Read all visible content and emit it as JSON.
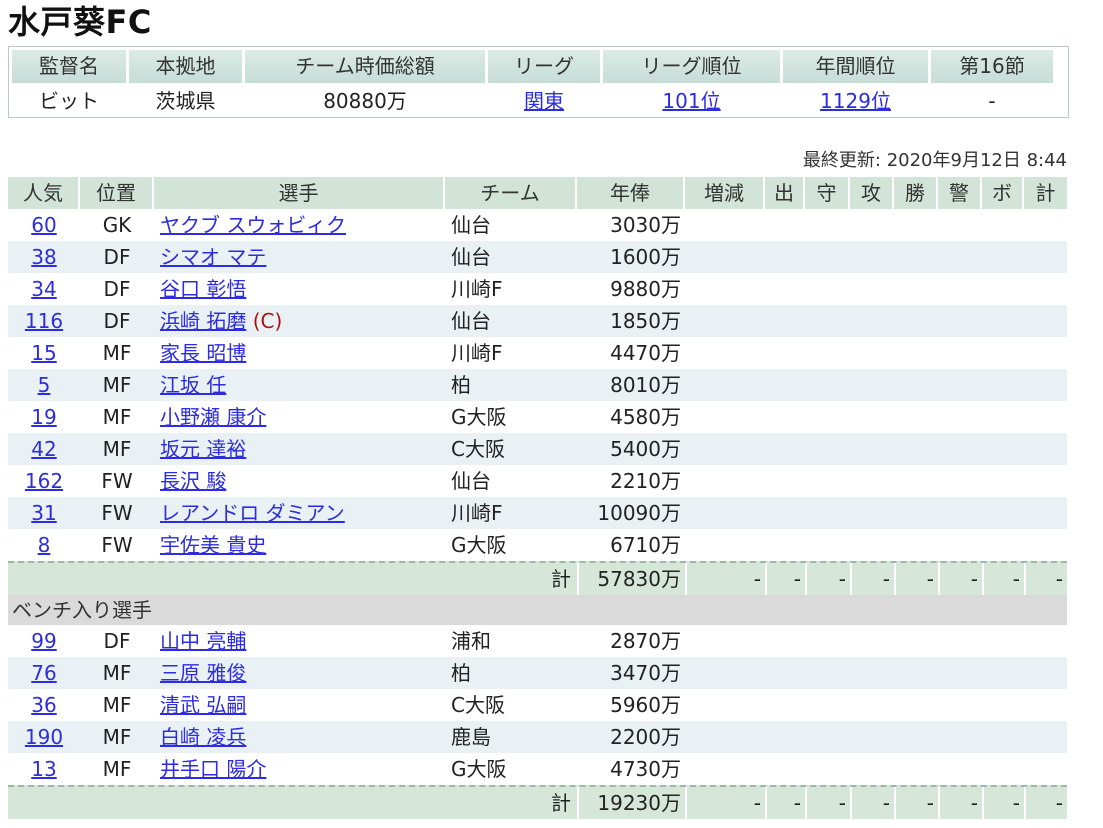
{
  "title": "水戸葵FC",
  "info": {
    "headers": [
      "監督名",
      "本拠地",
      "チーム時価総額",
      "リーグ",
      "リーグ順位",
      "年間順位",
      "第16節"
    ],
    "values": [
      "ビット",
      "茨城県",
      "80880万",
      "関東",
      "101位",
      "1129位",
      "-"
    ]
  },
  "updated": "最終更新: 2020年9月12日 8:44",
  "roster": {
    "headers": [
      "人気",
      "位置",
      "選手",
      "チーム",
      "年俸",
      "増減",
      "出",
      "守",
      "攻",
      "勝",
      "警",
      "ボ",
      "計"
    ],
    "starters": [
      {
        "pop": "60",
        "pos": "GK",
        "name": "ヤクブ スウォビィク",
        "captain": "",
        "team": "仙台",
        "salary": "3030万"
      },
      {
        "pop": "38",
        "pos": "DF",
        "name": "シマオ マテ",
        "captain": "",
        "team": "仙台",
        "salary": "1600万"
      },
      {
        "pop": "34",
        "pos": "DF",
        "name": "谷口 彰悟",
        "captain": "",
        "team": "川崎F",
        "salary": "9880万"
      },
      {
        "pop": "116",
        "pos": "DF",
        "name": "浜崎 拓磨",
        "captain": "(C)",
        "team": "仙台",
        "salary": "1850万"
      },
      {
        "pop": "15",
        "pos": "MF",
        "name": "家長 昭博",
        "captain": "",
        "team": "川崎F",
        "salary": "4470万"
      },
      {
        "pop": "5",
        "pos": "MF",
        "name": "江坂 任",
        "captain": "",
        "team": "柏",
        "salary": "8010万"
      },
      {
        "pop": "19",
        "pos": "MF",
        "name": "小野瀬 康介",
        "captain": "",
        "team": "G大阪",
        "salary": "4580万"
      },
      {
        "pop": "42",
        "pos": "MF",
        "name": "坂元 達裕",
        "captain": "",
        "team": "C大阪",
        "salary": "5400万"
      },
      {
        "pop": "162",
        "pos": "FW",
        "name": "長沢 駿",
        "captain": "",
        "team": "仙台",
        "salary": "2210万"
      },
      {
        "pop": "31",
        "pos": "FW",
        "name": "レアンドロ ダミアン",
        "captain": "",
        "team": "川崎F",
        "salary": "10090万"
      },
      {
        "pop": "8",
        "pos": "FW",
        "name": "宇佐美 貴史",
        "captain": "",
        "team": "G大阪",
        "salary": "6710万"
      }
    ],
    "starters_total": {
      "label": "計",
      "salary": "57830万",
      "stats": [
        "-",
        "-",
        "-",
        "-",
        "-",
        "-",
        "-",
        "-"
      ]
    },
    "bench_label": "ベンチ入り選手",
    "bench": [
      {
        "pop": "99",
        "pos": "DF",
        "name": "山中 亮輔",
        "captain": "",
        "team": "浦和",
        "salary": "2870万"
      },
      {
        "pop": "76",
        "pos": "MF",
        "name": "三原 雅俊",
        "captain": "",
        "team": "柏",
        "salary": "3470万"
      },
      {
        "pop": "36",
        "pos": "MF",
        "name": "清武 弘嗣",
        "captain": "",
        "team": "C大阪",
        "salary": "5960万"
      },
      {
        "pop": "190",
        "pos": "MF",
        "name": "白崎 凌兵",
        "captain": "",
        "team": "鹿島",
        "salary": "2200万"
      },
      {
        "pop": "13",
        "pos": "MF",
        "name": "井手口 陽介",
        "captain": "",
        "team": "G大阪",
        "salary": "4730万"
      }
    ],
    "bench_total": {
      "label": "計",
      "salary": "19230万",
      "stats": [
        "-",
        "-",
        "-",
        "-",
        "-",
        "-",
        "-",
        "-"
      ]
    }
  }
}
